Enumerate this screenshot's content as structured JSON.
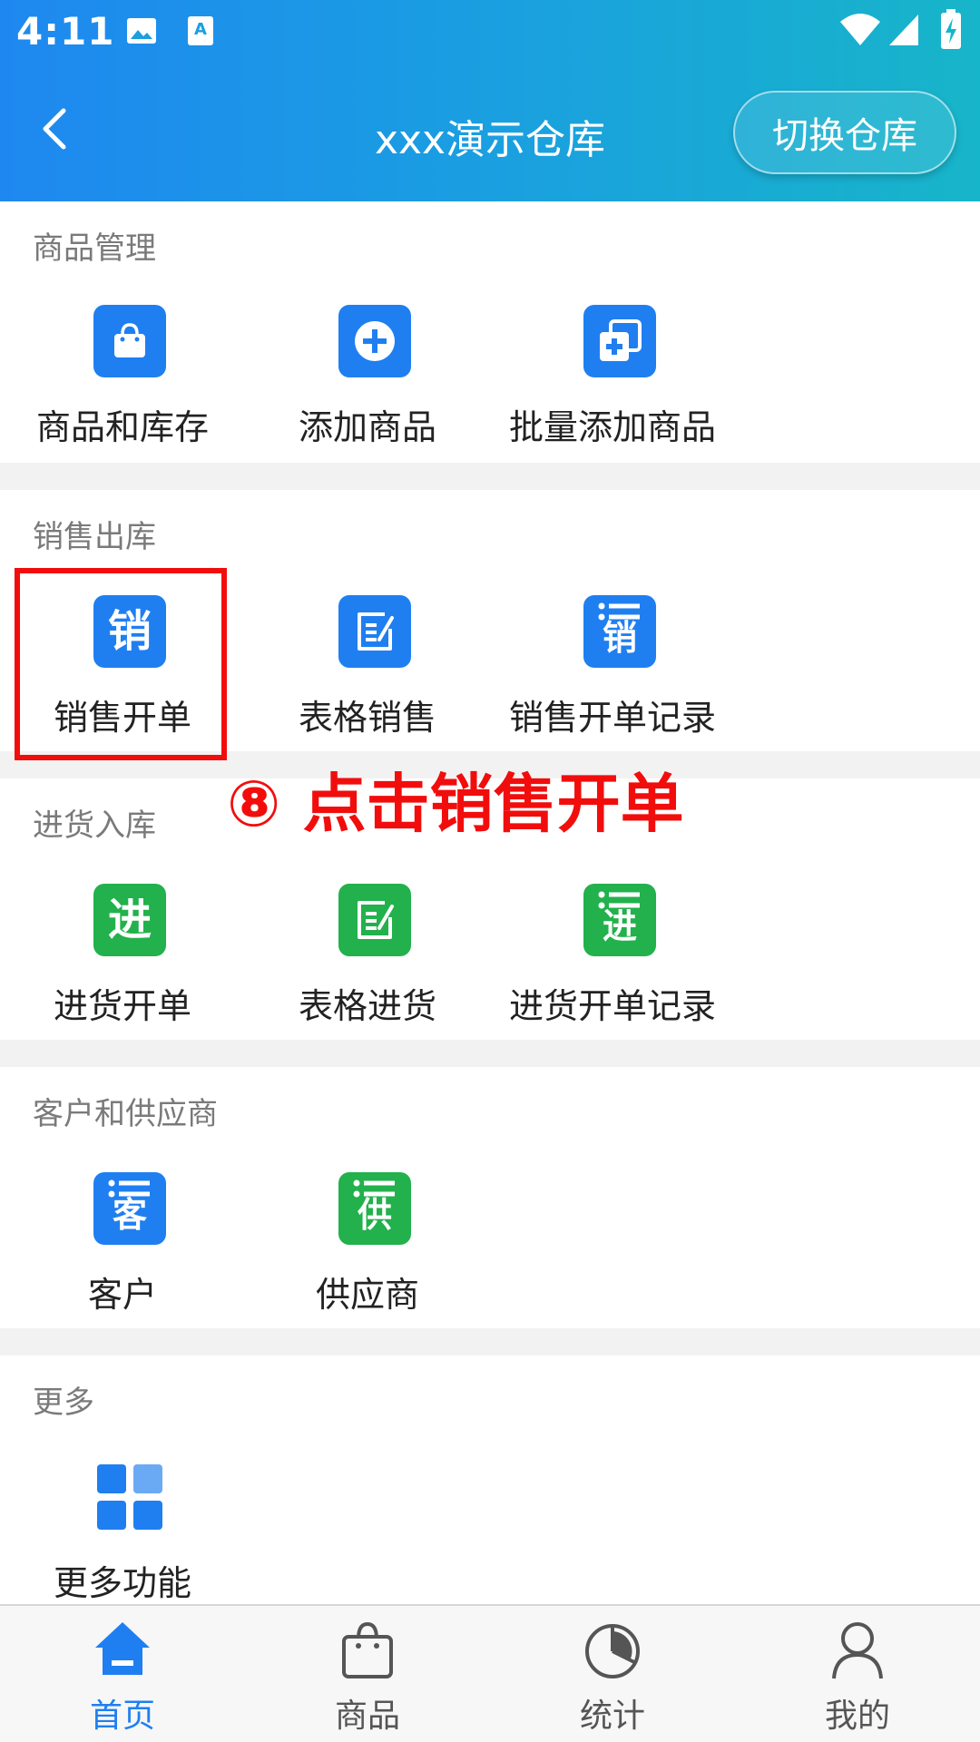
{
  "status_bar": {
    "time": "4:11"
  },
  "header": {
    "title": "xxx演示仓库",
    "switch_label": "切换仓库"
  },
  "sections": {
    "goods": {
      "title": "商品管理",
      "items": [
        {
          "label": "商品和库存",
          "icon": "shopping-bag-icon"
        },
        {
          "label": "添加商品",
          "icon": "add-circle-icon"
        },
        {
          "label": "批量添加商品",
          "icon": "batch-add-icon"
        }
      ]
    },
    "sales": {
      "title": "销售出库",
      "items": [
        {
          "label": "销售开单",
          "icon": "sales-order-icon",
          "glyph": "销"
        },
        {
          "label": "表格销售",
          "icon": "table-edit-icon"
        },
        {
          "label": "销售开单记录",
          "icon": "sales-record-icon",
          "glyph": "销"
        }
      ]
    },
    "purchase": {
      "title": "进货入库",
      "items": [
        {
          "label": "进货开单",
          "icon": "purchase-order-icon",
          "glyph": "进"
        },
        {
          "label": "表格进货",
          "icon": "table-edit-icon"
        },
        {
          "label": "进货开单记录",
          "icon": "purchase-record-icon",
          "glyph": "进"
        }
      ]
    },
    "partners": {
      "title": "客户和供应商",
      "items": [
        {
          "label": "客户",
          "icon": "customer-list-icon",
          "glyph": "客"
        },
        {
          "label": "供应商",
          "icon": "supplier-list-icon",
          "glyph": "供"
        }
      ]
    },
    "more": {
      "title": "更多",
      "items": [
        {
          "label": "更多功能",
          "icon": "grid-icon"
        }
      ]
    }
  },
  "annotation": {
    "text": "⑧ 点击销售开单"
  },
  "bottom_nav": [
    {
      "label": "首页",
      "icon": "home-icon",
      "active": true
    },
    {
      "label": "商品",
      "icon": "bag-icon",
      "active": false
    },
    {
      "label": "统计",
      "icon": "pie-chart-icon",
      "active": false
    },
    {
      "label": "我的",
      "icon": "user-icon",
      "active": false
    }
  ],
  "colors": {
    "accent": "#1f7ff0",
    "green": "#22b14c",
    "annotation_red": "#f20d0d"
  }
}
